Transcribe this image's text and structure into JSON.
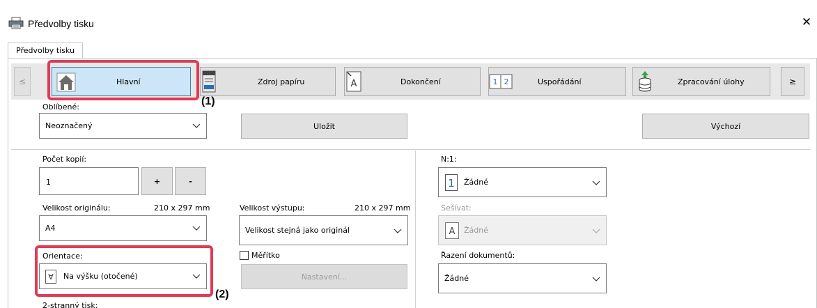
{
  "window": {
    "title": "Předvolby tisku",
    "close_icon": "close-icon"
  },
  "tab": {
    "label": "Předvolby tisku"
  },
  "nav": {
    "prev_label": "≤",
    "next_label": "≥",
    "items": [
      {
        "label": "Hlavní",
        "icon": "home-icon",
        "active": true
      },
      {
        "label": "Zdroj papíru",
        "icon": "paper-tray-icon"
      },
      {
        "label": "Dokončení",
        "icon": "finishing-icon"
      },
      {
        "label": "Uspořádání",
        "icon": "layout-icon"
      },
      {
        "label": "Zpracování úlohy",
        "icon": "job-handling-icon"
      }
    ]
  },
  "favorites": {
    "label": "Oblíbené:",
    "value": "Neoznačený",
    "save_label": "Uložit",
    "default_label": "Výchozí"
  },
  "copies": {
    "label": "Počet kopií:",
    "value": "1",
    "plus": "+",
    "minus": "-"
  },
  "original_size": {
    "label": "Velikost originálu:",
    "dims": "210 x 297 mm",
    "value": "A4"
  },
  "output_size": {
    "label": "Velikost výstupu:",
    "dims": "210 x 297 mm",
    "value": "Velikost stejná jako originál"
  },
  "orientation": {
    "label": "Orientace:",
    "value": "Na výšku (otočené)"
  },
  "scale": {
    "label": "Měřítko",
    "checked": false,
    "settings_label": "Nastavení..."
  },
  "duplex": {
    "label": "2-stranný tisk:"
  },
  "nup": {
    "label": "N:1:",
    "value": "Žádné",
    "icon_digit": "1"
  },
  "staple": {
    "label": "Sešívat:",
    "value": "Žádné",
    "icon_letter": "A"
  },
  "sort": {
    "label": "Řazení dokumentů:",
    "value": "Žádné"
  },
  "callouts": {
    "one": "(1)",
    "two": "(2)"
  },
  "colors": {
    "highlight": "#e03a55",
    "active_tab": "#cde6f7",
    "icon_blue": "#2b6fb5"
  }
}
